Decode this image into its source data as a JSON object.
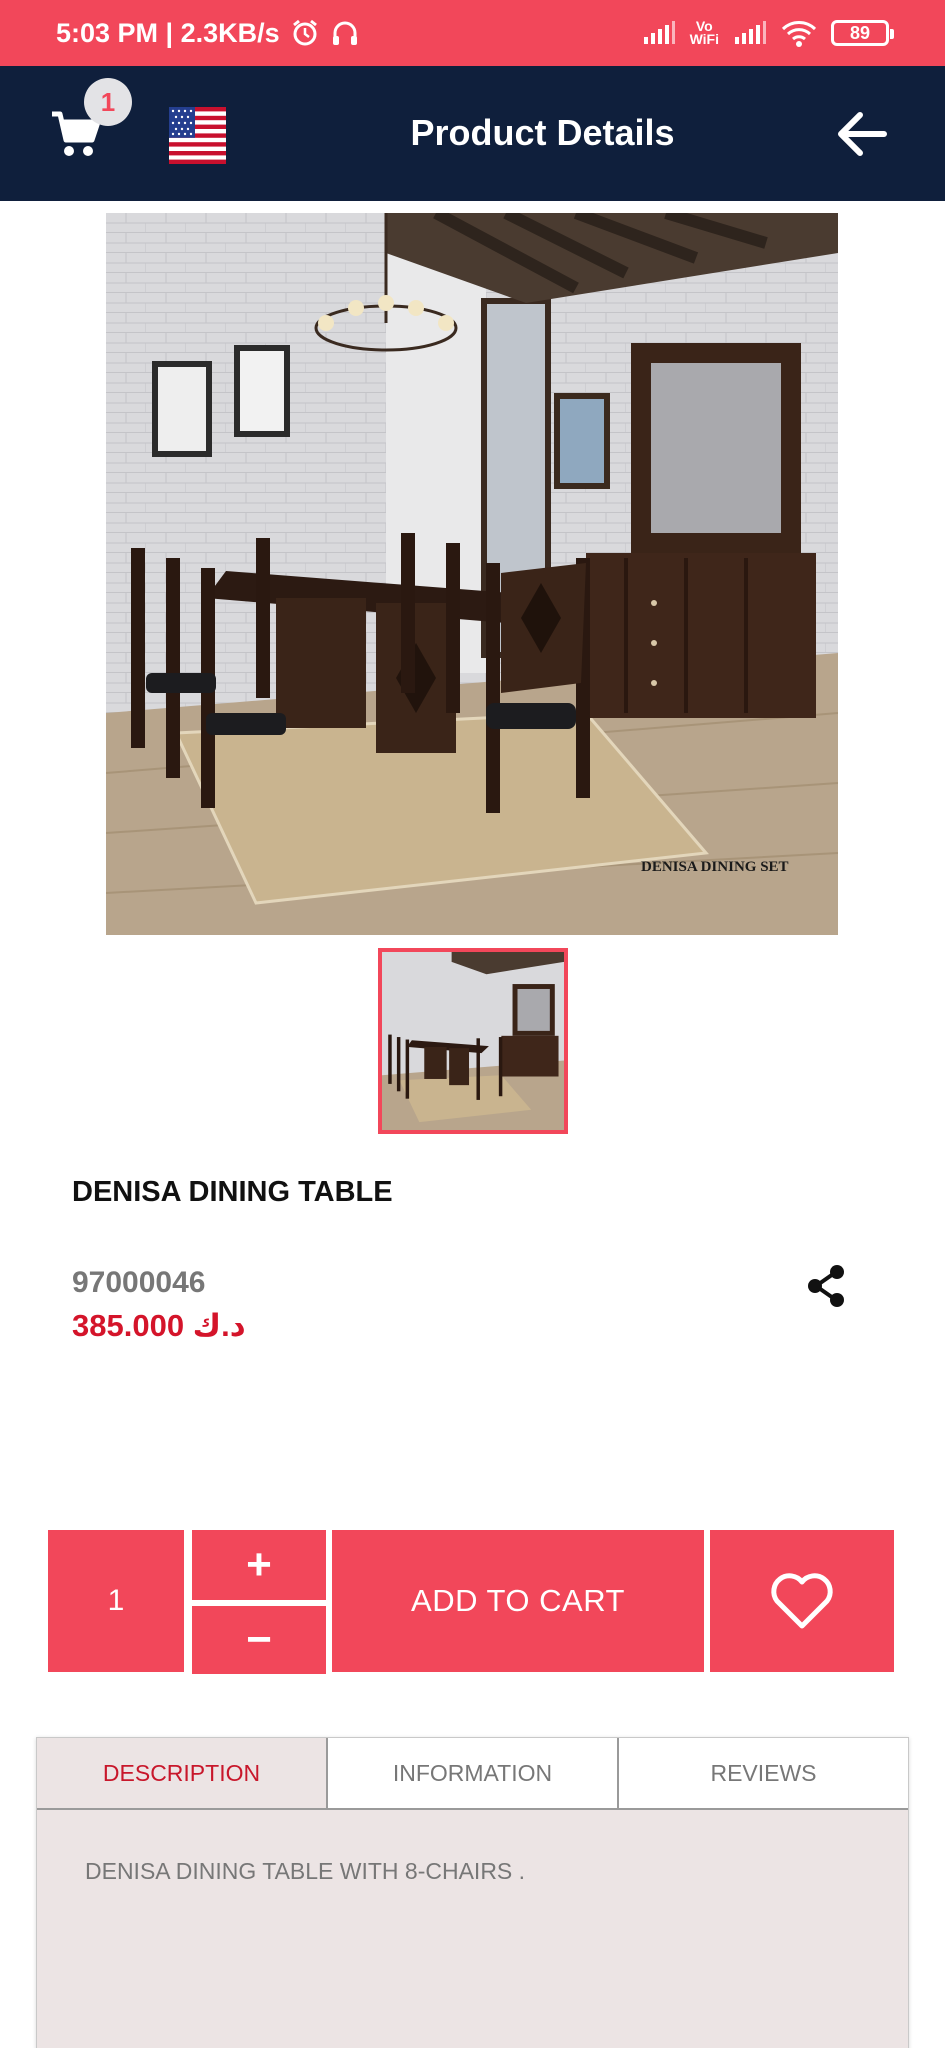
{
  "status_bar": {
    "time_speed": "5:03 PM | 2.3KB/s",
    "volte": "Vo\nWiFi",
    "battery": "89"
  },
  "app_bar": {
    "title": "Product Details",
    "cart_count": "1"
  },
  "product": {
    "image_caption": "DENISA DINING SET",
    "name": "DENISA DINING TABLE",
    "code": "97000046",
    "price": "385.000 د.ك"
  },
  "actions": {
    "quantity": "1",
    "plus": "+",
    "minus": "−",
    "add_to_cart": "ADD TO CART"
  },
  "tabs": [
    {
      "label": "DESCRIPTION",
      "active": true
    },
    {
      "label": "INFORMATION",
      "active": false
    },
    {
      "label": "REVIEWS",
      "active": false
    }
  ],
  "description": "DENISA DINING TABLE  WITH 8-CHAIRS .",
  "colors": {
    "accent": "#f2475a",
    "app_bar": "#0f1f3c",
    "price": "#d4142a"
  }
}
